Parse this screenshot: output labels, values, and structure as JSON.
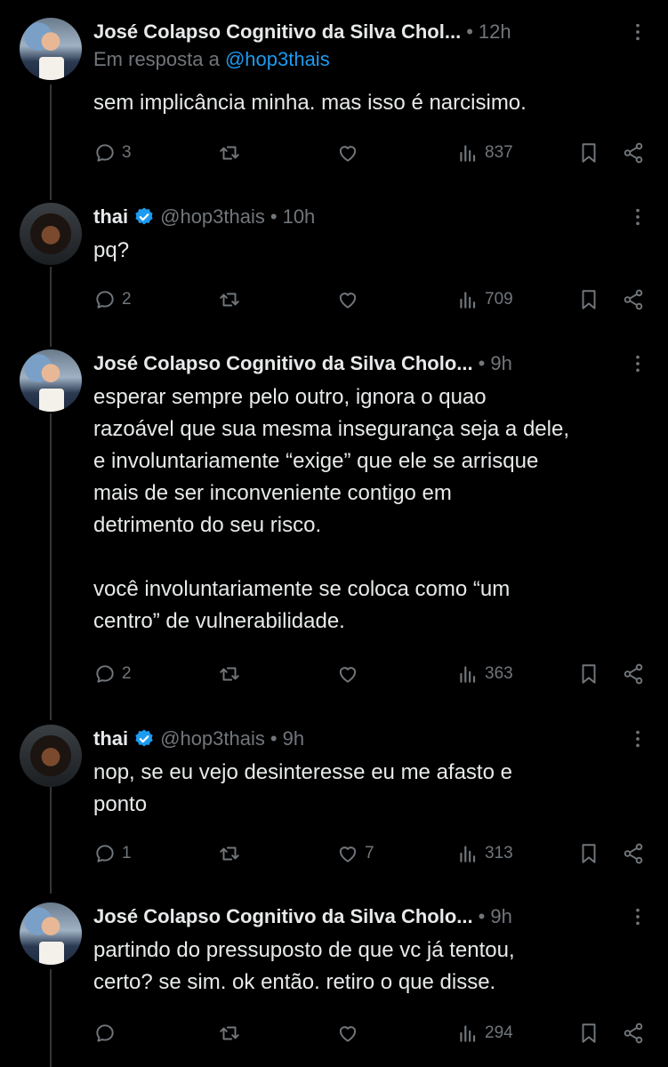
{
  "tweets": [
    {
      "name": "José Colapso Cognitivo da Silva Chol...",
      "handle": "",
      "time": "12h",
      "verified": false,
      "reply_prefix": "Em resposta a ",
      "reply_handle": "@hop3thais",
      "text": "sem implicância minha. mas isso é narcisimo.",
      "replies": "3",
      "retweets": "",
      "likes": "",
      "views": "837"
    },
    {
      "name": "thai",
      "handle": "@hop3thais",
      "time": "10h",
      "verified": true,
      "text": "pq?",
      "replies": "2",
      "retweets": "",
      "likes": "",
      "views": "709"
    },
    {
      "name": "José Colapso Cognitivo da Silva Cholo...",
      "handle": "",
      "time": "9h",
      "verified": false,
      "text": "esperar sempre pelo outro, ignora o quao\nrazoável que sua mesma insegurança seja a dele,\ne involuntariamente “exige” que ele se arrisque\nmais de ser inconveniente contigo em\ndetrimento do seu risco.\n\nvocê involuntariamente se coloca como “um\ncentro” de vulnerabilidade.",
      "replies": "2",
      "retweets": "",
      "likes": "",
      "views": "363"
    },
    {
      "name": "thai",
      "handle": "@hop3thais",
      "time": "9h",
      "verified": true,
      "text": "nop, se eu vejo desinteresse eu me afasto e\nponto",
      "replies": "1",
      "retweets": "",
      "likes": "7",
      "views": "313"
    },
    {
      "name": "José Colapso Cognitivo da Silva Cholo...",
      "handle": "",
      "time": "9h",
      "verified": false,
      "text": "partindo do pressuposto de que vc já tentou,\ncerto? se sim. ok então. retiro o que disse.",
      "replies": "",
      "retweets": "",
      "likes": "",
      "views": "294"
    }
  ],
  "icons": {
    "reply": "reply-icon",
    "retweet": "retweet-icon",
    "like": "heart-icon",
    "views": "views-icon",
    "bookmark": "bookmark-icon",
    "share": "share-icon",
    "more": "more-icon",
    "verified": "verified-badge-icon"
  },
  "colors": {
    "background": "#000000",
    "text": "#e7e9ea",
    "muted": "#71767b",
    "link": "#1d9bf0",
    "thread_line": "#333639"
  }
}
